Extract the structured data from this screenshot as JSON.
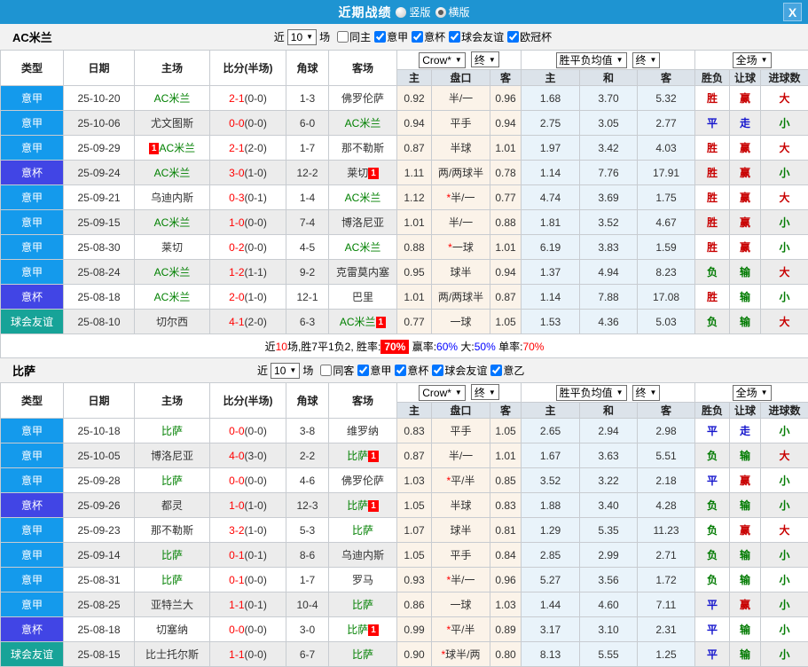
{
  "titlebar": {
    "title": "近期战绩",
    "radio_options": [
      {
        "label": "竖版",
        "selected": false
      },
      {
        "label": "横版",
        "selected": true
      }
    ],
    "close_label": "X"
  },
  "table": {
    "columns": [
      "类型",
      "日期",
      "主场",
      "比分(半场)",
      "角球",
      "客场",
      "主",
      "盘口",
      "客",
      "主",
      "和",
      "客",
      "胜负",
      "让球",
      "进球数"
    ],
    "dropdowns": {
      "odds_source": "Crow*",
      "final": "终",
      "avg_label": "胜平负均值",
      "scope": "全场",
      "arrow": "▼"
    }
  },
  "type_colors": {
    "意甲": "#149AEC",
    "意杯": "#4145E5",
    "球会友谊": "#17A398"
  },
  "accent_colors": {
    "titlebar_blue": "#1E94D2",
    "header_gray_blue": "#DCE3EA",
    "odds_cream": "#FBF3E9",
    "avg_light_blue": "#E9F3FA",
    "win_red": "#C80000",
    "draw_blue": "#1414CD",
    "lose_green": "#007A00",
    "focus_team_green": "#008000",
    "score_red": "#FF0000"
  },
  "sections": [
    {
      "team": "AC米兰",
      "filter": {
        "near_label": "近",
        "count": "10",
        "games_label": "场",
        "same_label": "同主",
        "same_checked": false,
        "leagues": [
          "意甲",
          "意杯",
          "球会友谊",
          "欧冠杯"
        ]
      },
      "rows": [
        {
          "type": "意甲",
          "date": "25-10-20",
          "home": "AC米兰",
          "hf": true,
          "hb": "",
          "score": "2-1",
          "half": "(0-0)",
          "corner": "1-3",
          "away": "佛罗伦萨",
          "af": false,
          "ab": "",
          "o1": "0.92",
          "star": "",
          "line": "半/一",
          "o2": "0.96",
          "a1": "1.68",
          "a2": "3.70",
          "a3": "5.32",
          "r1": "胜",
          "r2": "赢",
          "r3": "大"
        },
        {
          "type": "意甲",
          "date": "25-10-06",
          "home": "尤文图斯",
          "hf": false,
          "hb": "",
          "score": "0-0",
          "half": "(0-0)",
          "corner": "6-0",
          "away": "AC米兰",
          "af": true,
          "ab": "",
          "o1": "0.94",
          "star": "",
          "line": "平手",
          "o2": "0.94",
          "a1": "2.75",
          "a2": "3.05",
          "a3": "2.77",
          "r1": "平",
          "r2": "走",
          "r3": "小"
        },
        {
          "type": "意甲",
          "date": "25-09-29",
          "home": "AC米兰",
          "hf": true,
          "hb": "1",
          "score": "2-1",
          "half": "(2-0)",
          "corner": "1-7",
          "away": "那不勒斯",
          "af": false,
          "ab": "",
          "o1": "0.87",
          "star": "",
          "line": "半球",
          "o2": "1.01",
          "a1": "1.97",
          "a2": "3.42",
          "a3": "4.03",
          "r1": "胜",
          "r2": "赢",
          "r3": "大"
        },
        {
          "type": "意杯",
          "date": "25-09-24",
          "home": "AC米兰",
          "hf": true,
          "hb": "",
          "score": "3-0",
          "half": "(1-0)",
          "corner": "12-2",
          "away": "莱切",
          "af": false,
          "ab": "1",
          "o1": "1.11",
          "star": "",
          "line": "两/两球半",
          "o2": "0.78",
          "a1": "1.14",
          "a2": "7.76",
          "a3": "17.91",
          "r1": "胜",
          "r2": "赢",
          "r3": "小"
        },
        {
          "type": "意甲",
          "date": "25-09-21",
          "home": "乌迪内斯",
          "hf": false,
          "hb": "",
          "score": "0-3",
          "half": "(0-1)",
          "corner": "1-4",
          "away": "AC米兰",
          "af": true,
          "ab": "",
          "o1": "1.12",
          "star": "*",
          "line": "半/一",
          "o2": "0.77",
          "a1": "4.74",
          "a2": "3.69",
          "a3": "1.75",
          "r1": "胜",
          "r2": "赢",
          "r3": "大"
        },
        {
          "type": "意甲",
          "date": "25-09-15",
          "home": "AC米兰",
          "hf": true,
          "hb": "",
          "score": "1-0",
          "half": "(0-0)",
          "corner": "7-4",
          "away": "博洛尼亚",
          "af": false,
          "ab": "",
          "o1": "1.01",
          "star": "",
          "line": "半/一",
          "o2": "0.88",
          "a1": "1.81",
          "a2": "3.52",
          "a3": "4.67",
          "r1": "胜",
          "r2": "赢",
          "r3": "小"
        },
        {
          "type": "意甲",
          "date": "25-08-30",
          "home": "莱切",
          "hf": false,
          "hb": "",
          "score": "0-2",
          "half": "(0-0)",
          "corner": "4-5",
          "away": "AC米兰",
          "af": true,
          "ab": "",
          "o1": "0.88",
          "star": "*",
          "line": "一球",
          "o2": "1.01",
          "a1": "6.19",
          "a2": "3.83",
          "a3": "1.59",
          "r1": "胜",
          "r2": "赢",
          "r3": "小"
        },
        {
          "type": "意甲",
          "date": "25-08-24",
          "home": "AC米兰",
          "hf": true,
          "hb": "",
          "score": "1-2",
          "half": "(1-1)",
          "corner": "9-2",
          "away": "克雷莫内塞",
          "af": false,
          "ab": "",
          "o1": "0.95",
          "star": "",
          "line": "球半",
          "o2": "0.94",
          "a1": "1.37",
          "a2": "4.94",
          "a3": "8.23",
          "r1": "负",
          "r2": "输",
          "r3": "大"
        },
        {
          "type": "意杯",
          "date": "25-08-18",
          "home": "AC米兰",
          "hf": true,
          "hb": "",
          "score": "2-0",
          "half": "(1-0)",
          "corner": "12-1",
          "away": "巴里",
          "af": false,
          "ab": "",
          "o1": "1.01",
          "star": "",
          "line": "两/两球半",
          "o2": "0.87",
          "a1": "1.14",
          "a2": "7.88",
          "a3": "17.08",
          "r1": "胜",
          "r2": "输",
          "r3": "小"
        },
        {
          "type": "球会友谊",
          "date": "25-08-10",
          "home": "切尔西",
          "hf": false,
          "hb": "",
          "score": "4-1",
          "half": "(2-0)",
          "corner": "6-3",
          "away": "AC米兰",
          "af": true,
          "ab": "1",
          "o1": "0.77",
          "star": "",
          "line": "一球",
          "o2": "1.05",
          "a1": "1.53",
          "a2": "4.36",
          "a3": "5.03",
          "r1": "负",
          "r2": "输",
          "r3": "大"
        }
      ],
      "summary": [
        {
          "text": "近",
          "style": ""
        },
        {
          "text": "10",
          "style": "s-red"
        },
        {
          "text": "场,胜7平1负2, 胜率:",
          "style": ""
        },
        {
          "text": "70%",
          "style": "s-hl"
        },
        {
          "text": " 赢率:",
          "style": ""
        },
        {
          "text": "60%",
          "style": "s-blue"
        },
        {
          "text": " 大:",
          "style": ""
        },
        {
          "text": "50%",
          "style": "s-blue"
        },
        {
          "text": " 单率:",
          "style": ""
        },
        {
          "text": "70%",
          "style": "s-red"
        }
      ]
    },
    {
      "team": "比萨",
      "filter": {
        "near_label": "近",
        "count": "10",
        "games_label": "场",
        "same_label": "同客",
        "same_checked": false,
        "leagues": [
          "意甲",
          "意杯",
          "球会友谊",
          "意乙"
        ]
      },
      "rows": [
        {
          "type": "意甲",
          "date": "25-10-18",
          "home": "比萨",
          "hf": true,
          "hb": "",
          "score": "0-0",
          "half": "(0-0)",
          "corner": "3-8",
          "away": "维罗纳",
          "af": false,
          "ab": "",
          "o1": "0.83",
          "star": "",
          "line": "平手",
          "o2": "1.05",
          "a1": "2.65",
          "a2": "2.94",
          "a3": "2.98",
          "r1": "平",
          "r2": "走",
          "r3": "小"
        },
        {
          "type": "意甲",
          "date": "25-10-05",
          "home": "博洛尼亚",
          "hf": false,
          "hb": "",
          "score": "4-0",
          "half": "(3-0)",
          "corner": "2-2",
          "away": "比萨",
          "af": true,
          "ab": "1",
          "o1": "0.87",
          "star": "",
          "line": "半/一",
          "o2": "1.01",
          "a1": "1.67",
          "a2": "3.63",
          "a3": "5.51",
          "r1": "负",
          "r2": "输",
          "r3": "大"
        },
        {
          "type": "意甲",
          "date": "25-09-28",
          "home": "比萨",
          "hf": true,
          "hb": "",
          "score": "0-0",
          "half": "(0-0)",
          "corner": "4-6",
          "away": "佛罗伦萨",
          "af": false,
          "ab": "",
          "o1": "1.03",
          "star": "*",
          "line": "平/半",
          "o2": "0.85",
          "a1": "3.52",
          "a2": "3.22",
          "a3": "2.18",
          "r1": "平",
          "r2": "赢",
          "r3": "小"
        },
        {
          "type": "意杯",
          "date": "25-09-26",
          "home": "都灵",
          "hf": false,
          "hb": "",
          "score": "1-0",
          "half": "(1-0)",
          "corner": "12-3",
          "away": "比萨",
          "af": true,
          "ab": "1",
          "o1": "1.05",
          "star": "",
          "line": "半球",
          "o2": "0.83",
          "a1": "1.88",
          "a2": "3.40",
          "a3": "4.28",
          "r1": "负",
          "r2": "输",
          "r3": "小"
        },
        {
          "type": "意甲",
          "date": "25-09-23",
          "home": "那不勒斯",
          "hf": false,
          "hb": "",
          "score": "3-2",
          "half": "(1-0)",
          "corner": "5-3",
          "away": "比萨",
          "af": true,
          "ab": "",
          "o1": "1.07",
          "star": "",
          "line": "球半",
          "o2": "0.81",
          "a1": "1.29",
          "a2": "5.35",
          "a3": "11.23",
          "r1": "负",
          "r2": "赢",
          "r3": "大"
        },
        {
          "type": "意甲",
          "date": "25-09-14",
          "home": "比萨",
          "hf": true,
          "hb": "",
          "score": "0-1",
          "half": "(0-1)",
          "corner": "8-6",
          "away": "乌迪内斯",
          "af": false,
          "ab": "",
          "o1": "1.05",
          "star": "",
          "line": "平手",
          "o2": "0.84",
          "a1": "2.85",
          "a2": "2.99",
          "a3": "2.71",
          "r1": "负",
          "r2": "输",
          "r3": "小"
        },
        {
          "type": "意甲",
          "date": "25-08-31",
          "home": "比萨",
          "hf": true,
          "hb": "",
          "score": "0-1",
          "half": "(0-0)",
          "corner": "1-7",
          "away": "罗马",
          "af": false,
          "ab": "",
          "o1": "0.93",
          "star": "*",
          "line": "半/一",
          "o2": "0.96",
          "a1": "5.27",
          "a2": "3.56",
          "a3": "1.72",
          "r1": "负",
          "r2": "输",
          "r3": "小"
        },
        {
          "type": "意甲",
          "date": "25-08-25",
          "home": "亚特兰大",
          "hf": false,
          "hb": "",
          "score": "1-1",
          "half": "(0-1)",
          "corner": "10-4",
          "away": "比萨",
          "af": true,
          "ab": "",
          "o1": "0.86",
          "star": "",
          "line": "一球",
          "o2": "1.03",
          "a1": "1.44",
          "a2": "4.60",
          "a3": "7.11",
          "r1": "平",
          "r2": "赢",
          "r3": "小"
        },
        {
          "type": "意杯",
          "date": "25-08-18",
          "home": "切塞纳",
          "hf": false,
          "hb": "",
          "score": "0-0",
          "half": "(0-0)",
          "corner": "3-0",
          "away": "比萨",
          "af": true,
          "ab": "1",
          "o1": "0.99",
          "star": "*",
          "line": "平/半",
          "o2": "0.89",
          "a1": "3.17",
          "a2": "3.10",
          "a3": "2.31",
          "r1": "平",
          "r2": "输",
          "r3": "小"
        },
        {
          "type": "球会友谊",
          "date": "25-08-15",
          "home": "比士托尔斯",
          "hf": false,
          "hb": "",
          "score": "1-1",
          "half": "(0-0)",
          "corner": "6-7",
          "away": "比萨",
          "af": true,
          "ab": "",
          "o1": "0.90",
          "star": "*",
          "line": "球半/两",
          "o2": "0.80",
          "a1": "8.13",
          "a2": "5.55",
          "a3": "1.25",
          "r1": "平",
          "r2": "输",
          "r3": "小"
        }
      ],
      "summary": null
    }
  ]
}
